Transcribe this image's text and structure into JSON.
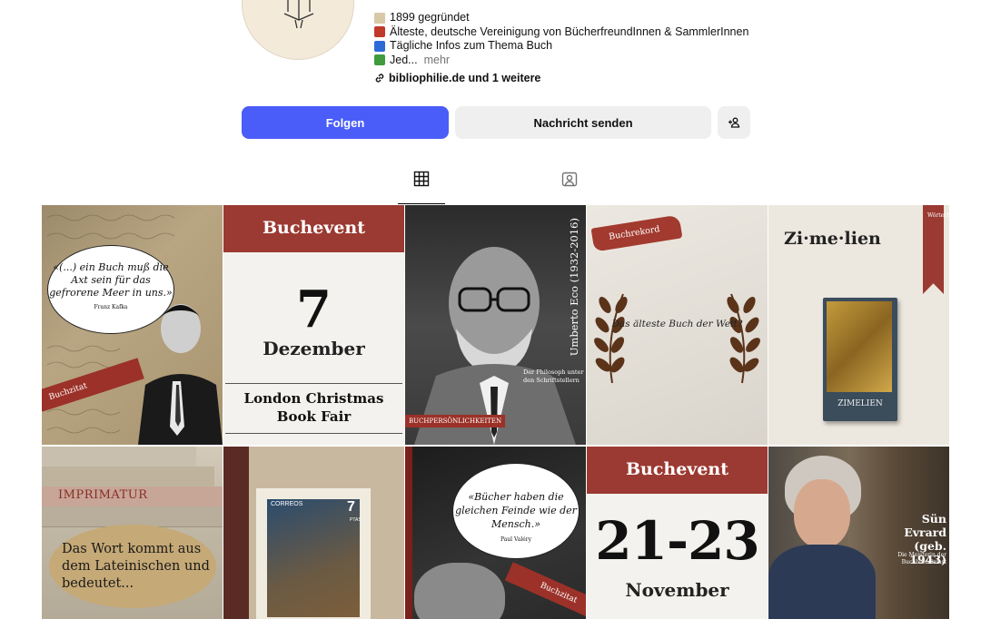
{
  "profile": {
    "bio": [
      {
        "icon": "open-book-icon",
        "text": "1899 gegründet"
      },
      {
        "icon": "red-book-icon",
        "text": "Älteste, deutsche Vereinigung von BücherfreundInnen & SammlerInnen"
      },
      {
        "icon": "blue-book-icon",
        "text": "Tägliche Infos zum Thema Buch"
      },
      {
        "icon": "green-book-icon",
        "text": "Jed..."
      }
    ],
    "more_label": "mehr",
    "link_text": "bibliophilie.de und 1 weitere"
  },
  "actions": {
    "follow_label": "Folgen",
    "message_label": "Nachricht senden",
    "follow_color": "#4a5df9"
  },
  "tabs": [
    {
      "name": "posts",
      "icon": "grid-icon",
      "active": true
    },
    {
      "name": "tagged",
      "icon": "tagged-person-icon",
      "active": false
    }
  ],
  "posts": {
    "kafka": {
      "quote": "«(...) ein Buch muß die Axt sein für das gefrorene Meer in uns.»",
      "author": "Franz Kafka",
      "tag": "Buchzitat"
    },
    "event1": {
      "header": "Buchevent",
      "day": "7",
      "month": "Dezember",
      "name": "London Christmas Book Fair"
    },
    "eco": {
      "vertical": "Umberto Eco (1932-2016)",
      "caption": "Der Philosoph unter den Schriftstellern",
      "tag": "BUCHPERSÖNLICHKEITEN"
    },
    "rekord": {
      "tag": "Buchrekord",
      "question": "Das älteste Buch der Welt?"
    },
    "zimelien": {
      "title": "Zi·me·lien",
      "flag": "WörterBuch",
      "book_title": "ZIMELIEN"
    },
    "imprimatur": {
      "title": "IMPRIMATUR",
      "text": "Das Wort kommt aus dem Lateinischen und bedeutet..."
    },
    "stamp": {
      "brand": "CORREOS",
      "value": "7",
      "unit": "PTAS"
    },
    "valery": {
      "quote": "«Bücher haben die gleichen Feinde wie der Mensch.»",
      "author": "Paul Valéry",
      "tag": "Buchzitat"
    },
    "event2": {
      "header": "Buchevent",
      "days": "21-23",
      "month": "November"
    },
    "evrard": {
      "name": "Sün Evrard (geb. 1943)",
      "subtitle": "Die Meisterin der Buchbindekunst"
    }
  }
}
